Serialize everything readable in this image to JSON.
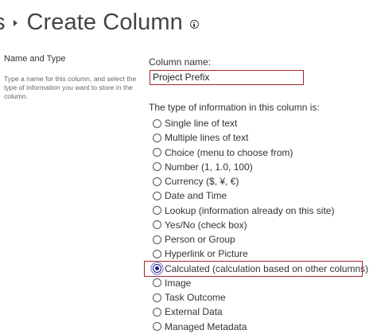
{
  "header": {
    "breadcrumb_tail": "s",
    "title": "Create Column",
    "info_icon": "info-circle-icon"
  },
  "section": {
    "title": "Name and Type",
    "description": "Type a name for this column, and select the type of information you want to store in the column."
  },
  "column_name": {
    "label": "Column name:",
    "value": "Project Prefix"
  },
  "type_info": {
    "label": "The type of information in this column is:",
    "options": [
      {
        "label": "Single line of text",
        "selected": false
      },
      {
        "label": "Multiple lines of text",
        "selected": false
      },
      {
        "label": "Choice (menu to choose from)",
        "selected": false
      },
      {
        "label": "Number (1, 1.0, 100)",
        "selected": false
      },
      {
        "label": "Currency ($, ¥, €)",
        "selected": false
      },
      {
        "label": "Date and Time",
        "selected": false
      },
      {
        "label": "Lookup (information already on this site)",
        "selected": false
      },
      {
        "label": "Yes/No (check box)",
        "selected": false
      },
      {
        "label": "Person or Group",
        "selected": false
      },
      {
        "label": "Hyperlink or Picture",
        "selected": false
      },
      {
        "label": "Calculated (calculation based on other columns)",
        "selected": true
      },
      {
        "label": "Image",
        "selected": false
      },
      {
        "label": "Task Outcome",
        "selected": false
      },
      {
        "label": "External Data",
        "selected": false
      },
      {
        "label": "Managed Metadata",
        "selected": false
      }
    ]
  },
  "colors": {
    "highlight_border": "#a3262e",
    "radio_selected": "#1a1a8c",
    "text": "#333333"
  }
}
